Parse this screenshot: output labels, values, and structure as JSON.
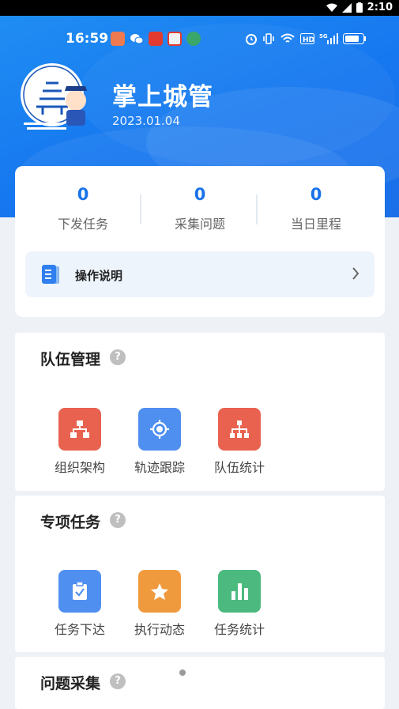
{
  "system_status": {
    "time": "2:10"
  },
  "phone_status": {
    "time": "16:59"
  },
  "header": {
    "app_title": "掌上城管",
    "date": "2023.01.04"
  },
  "stats": [
    {
      "value": "0",
      "label": "下发任务"
    },
    {
      "value": "0",
      "label": "采集问题"
    },
    {
      "value": "0",
      "label": "当日里程"
    }
  ],
  "guide": {
    "label": "操作说明"
  },
  "team": {
    "title": "队伍管理",
    "help": "?",
    "tiles": [
      {
        "label": "组织架构",
        "icon": "org-chart-icon",
        "color": "#e8624f"
      },
      {
        "label": "轨迹跟踪",
        "icon": "locate-icon",
        "color": "#4f8ff0"
      },
      {
        "label": "队伍统计",
        "icon": "team-stats-icon",
        "color": "#e8624f"
      }
    ]
  },
  "special": {
    "title": "专项任务",
    "help": "?",
    "tiles": [
      {
        "label": "任务下达",
        "icon": "clipboard-check-icon",
        "color": "#4f8ff0"
      },
      {
        "label": "执行动态",
        "icon": "star-icon",
        "color": "#f09a3e"
      },
      {
        "label": "任务统计",
        "icon": "bar-chart-icon",
        "color": "#4cba7f"
      }
    ]
  },
  "problems": {
    "title": "问题采集",
    "help": "?"
  }
}
